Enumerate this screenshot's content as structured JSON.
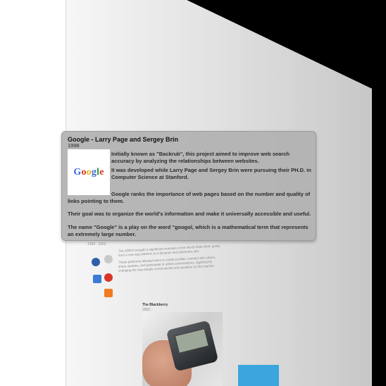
{
  "tooltip": {
    "title": "Google - Larry Page and Sergey Brin",
    "year": "1998",
    "logo_text": "Google",
    "paragraphs": [
      "Initially known as \"Backrub\", this project aimed to improve web search accuracy by analyzing the relationships between websites.",
      "It was developed while Larry Page and Sergey Brin were pursuing their PH.D. in Computer Science at Stanford.",
      "Google ranks the importance of web pages based on the number and quality of links pointing to them.",
      "Their goal was to organize the world's information and make it universally accessible and useful.",
      "The name \"Google\" is a play on the word \"googol, which is a mathematical term that represents an extremely large number."
    ]
  },
  "background": {
    "years": "1999 - 2002",
    "desc1": "The 2000's brought a significant evolution of the World Wide Web, going from a one-way platform to a dynamic and interactive site.",
    "desc2": "These platforms allowed users to create profiles, connect with others, share updates, and participate in online conversations, significantly changing the way people communicate and socialize on the internet.",
    "blackberry_title": "The Blackberry",
    "blackberry_year": "2002"
  },
  "colors": {
    "tooltip_bg": "#b2b2b2",
    "accent_blue": "#3aa6dd"
  }
}
